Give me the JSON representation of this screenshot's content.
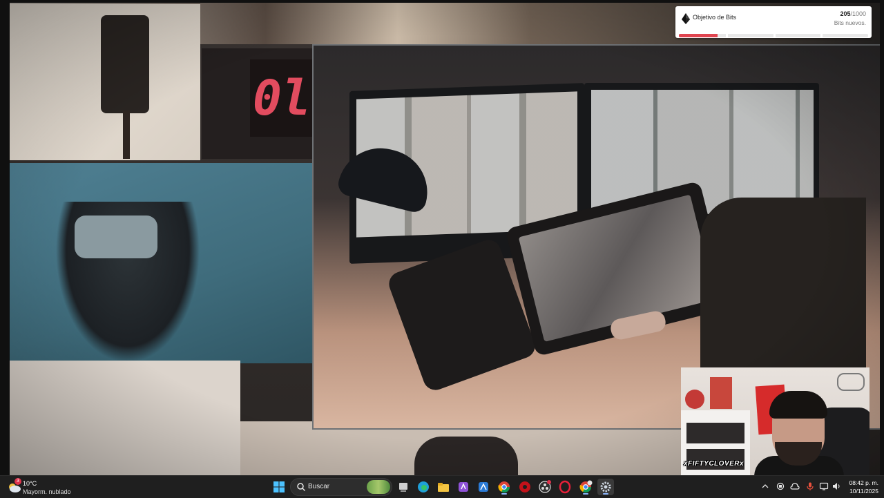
{
  "bits_goal": {
    "title": "Objetivo de Bits",
    "current": "205",
    "total": "/1000",
    "subtitle": "Bits nuevos.",
    "progress_fraction": 0.205,
    "fill_color": "#e04550"
  },
  "facecam": {
    "username_overlay": "xFIFTYCLOVERx"
  },
  "scene": {
    "clock_digits": "0l"
  },
  "taskbar": {
    "weather": {
      "temperature": "10°C",
      "condition": "Mayorm. nublado",
      "badge": "3"
    },
    "start_icon": "windows-start-icon",
    "search": {
      "label": "Buscar"
    },
    "apps": [
      {
        "name": "task-view-icon"
      },
      {
        "name": "edge-icon"
      },
      {
        "name": "file-explorer-icon"
      },
      {
        "name": "purple-app-icon"
      },
      {
        "name": "store-icon"
      },
      {
        "name": "chrome-icon"
      },
      {
        "name": "red-app-icon"
      },
      {
        "name": "obs-icon"
      },
      {
        "name": "opera-gx-icon"
      },
      {
        "name": "chrome-profile-icon"
      },
      {
        "name": "settings-icon"
      }
    ],
    "tray": [
      {
        "name": "chevron-up-icon"
      },
      {
        "name": "sync-icon"
      },
      {
        "name": "cloud-icon"
      },
      {
        "name": "microphone-icon"
      },
      {
        "name": "display-icon"
      },
      {
        "name": "volume-icon"
      }
    ],
    "clock": {
      "time": "08:42 p. m.",
      "date": "10/11/2025"
    }
  }
}
